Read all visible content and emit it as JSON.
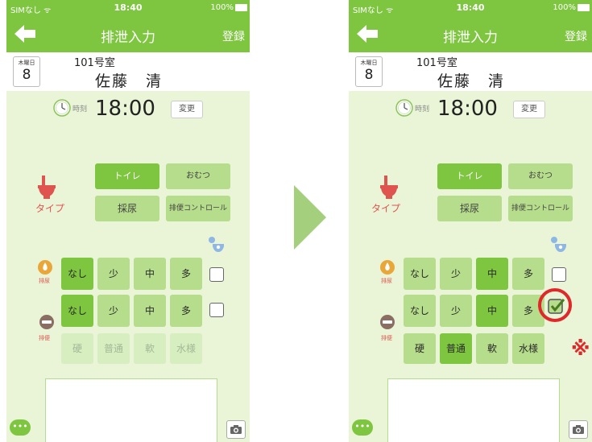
{
  "status": {
    "carrier": "SIMなし ᯤ",
    "time": "18:40",
    "battery": "100%"
  },
  "nav": {
    "title": "排泄入力",
    "register": "登録"
  },
  "header": {
    "weekday": "木曜日",
    "day": "8",
    "room": "101号室",
    "name": "佐藤　清"
  },
  "time": {
    "label": "時刻",
    "value": "18:00",
    "change": "変更"
  },
  "type": {
    "label": "タイプ",
    "toilet": "トイレ",
    "diaper": "おむつ",
    "urine_collect": "採尿",
    "stool_control": "排便コントロール"
  },
  "urination": {
    "label": "排尿",
    "levels": [
      "なし",
      "少",
      "中",
      "多"
    ]
  },
  "defecation": {
    "label": "排便",
    "levels": [
      "なし",
      "少",
      "中",
      "多"
    ],
    "consistency": [
      "硬",
      "普通",
      "軟",
      "水様"
    ]
  },
  "memo": {
    "text": ""
  },
  "comment_icon": "•••",
  "annotation": {
    "mark": "※"
  },
  "colors": {
    "primary": "#7ec540",
    "background": "#e9f5d6",
    "button_light": "#b6dd8b",
    "accent_red": "#e05450",
    "arrow": "#a4cf7d",
    "highlight": "#e0282a"
  }
}
